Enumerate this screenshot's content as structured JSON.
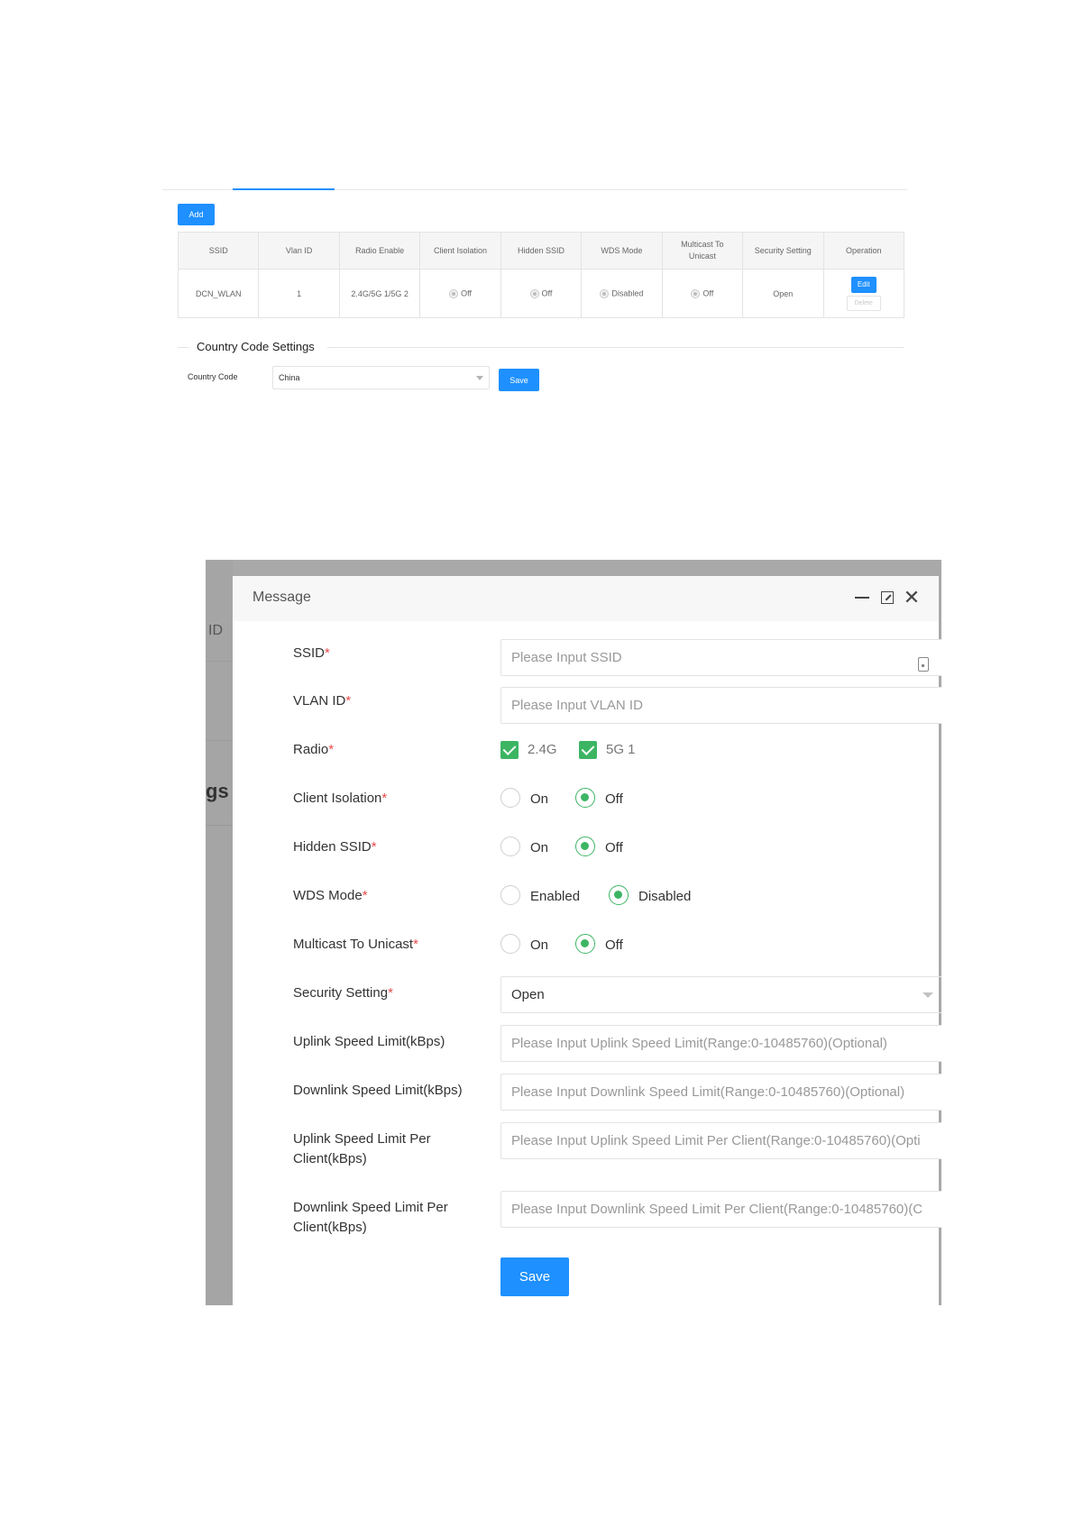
{
  "wlan_list": {
    "add_label": "Add",
    "columns": [
      "SSID",
      "Vlan ID",
      "Radio Enable",
      "Client Isolation",
      "Hidden SSID",
      "WDS Mode",
      "Multicast To Unicast",
      "Security Setting",
      "Operation"
    ],
    "row": {
      "ssid": "DCN_WLAN",
      "vlan_id": "1",
      "radio_enable": "2.4G/5G 1/5G 2",
      "client_isolation": "Off",
      "hidden_ssid": "Off",
      "wds_mode": "Disabled",
      "multicast_to_unicast": "Off",
      "security_setting": "Open",
      "edit_label": "Edit",
      "delete_label": "Delete"
    }
  },
  "country_code_settings": {
    "title": "Country Code Settings",
    "label": "Country Code",
    "value": "China",
    "save_label": "Save"
  },
  "background": {
    "fragment_id": "ID",
    "fragment_gs": "gs"
  },
  "dialog": {
    "title": "Message",
    "fields": {
      "ssid": {
        "label": "SSID",
        "placeholder": "Please Input SSID"
      },
      "vlan_id": {
        "label": "VLAN ID",
        "placeholder": "Please Input VLAN ID"
      },
      "radio": {
        "label": "Radio",
        "options": [
          "2.4G",
          "5G 1"
        ],
        "checked": [
          true,
          true
        ]
      },
      "client_isolation": {
        "label": "Client Isolation",
        "on": "On",
        "off": "Off",
        "selected": "Off"
      },
      "hidden_ssid": {
        "label": "Hidden SSID",
        "on": "On",
        "off": "Off",
        "selected": "Off"
      },
      "wds_mode": {
        "label": "WDS Mode",
        "on": "Enabled",
        "off": "Disabled",
        "selected": "Disabled"
      },
      "multicast_to_unicast": {
        "label": "Multicast To Unicast",
        "on": "On",
        "off": "Off",
        "selected": "Off"
      },
      "security_setting": {
        "label": "Security Setting",
        "value": "Open"
      },
      "uplink_limit": {
        "label": "Uplink Speed Limit(kBps)",
        "placeholder": "Please Input Uplink Speed Limit(Range:0-10485760)(Optional)"
      },
      "downlink_limit": {
        "label": "Downlink Speed Limit(kBps)",
        "placeholder": "Please Input Downlink Speed Limit(Range:0-10485760)(Optional)"
      },
      "uplink_per_client": {
        "label_line1": "Uplink Speed Limit Per",
        "label_line2": "Client(kBps)",
        "placeholder": "Please Input Uplink Speed Limit Per Client(Range:0-10485760)(Opti"
      },
      "downlink_per_client": {
        "label_line1": "Downlink Speed Limit Per",
        "label_line2": "Client(kBps)",
        "placeholder": "Please Input Downlink Speed Limit Per Client(Range:0-10485760)(C"
      }
    },
    "required_marker": "*",
    "save_label": "Save"
  }
}
